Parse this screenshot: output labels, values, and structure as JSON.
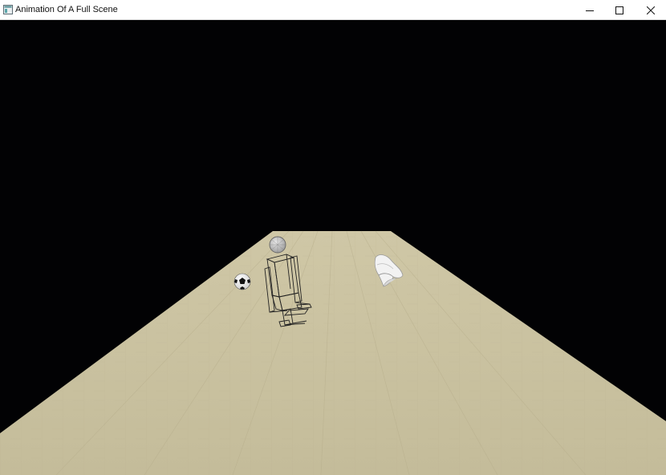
{
  "window": {
    "title": "Animation Of A Full Scene",
    "app_icon": "window-app-icon",
    "controls": {
      "minimize_icon": "minimize-icon",
      "maximize_icon": "maximize-icon",
      "close_icon": "close-icon"
    }
  },
  "scene": {
    "background_color": "#020204",
    "floor_color": "#cdc4a3",
    "floor_texture": "light wood planks",
    "objects": [
      "soccer-ball",
      "wireframe-figure",
      "white-shoe"
    ]
  }
}
